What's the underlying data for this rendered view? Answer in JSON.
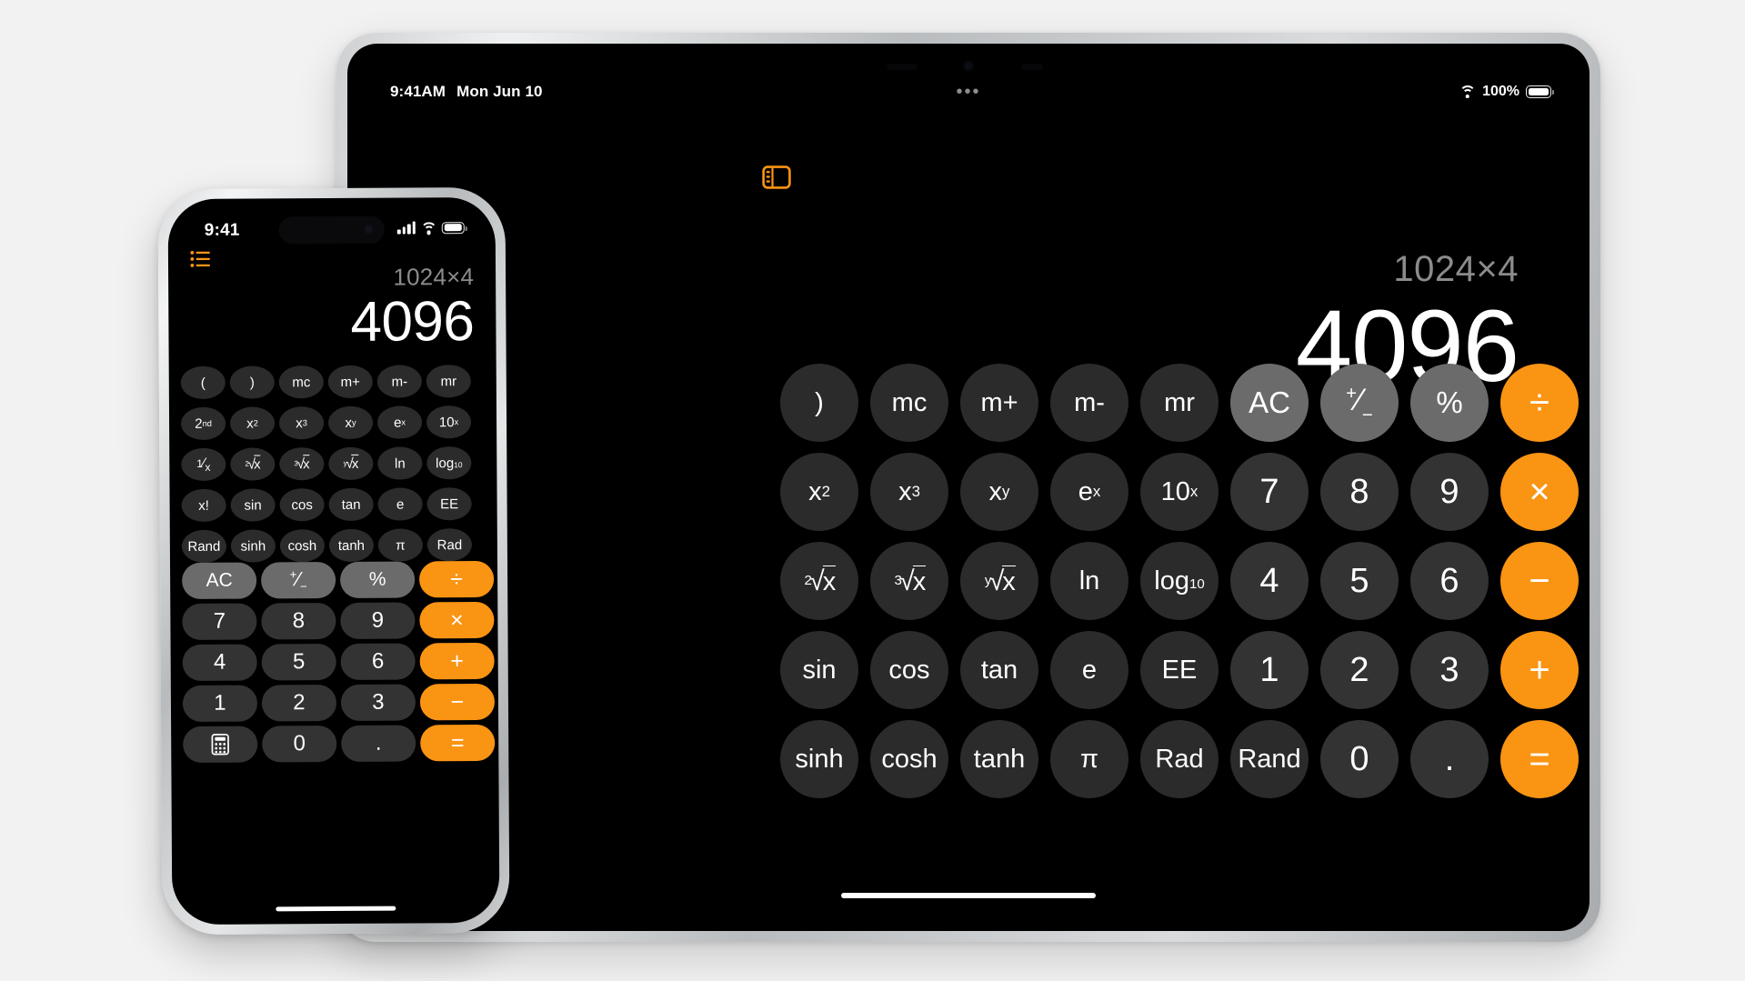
{
  "scene": {
    "background_color": "#f2f2f2"
  },
  "ipad": {
    "device_name": "iPad",
    "status_bar": {
      "time": "9:41AM",
      "date": "Mon Jun 10",
      "wifi_icon": "wifi-icon",
      "battery_percent": "100%",
      "battery_icon": "battery-full-icon"
    },
    "sidebar_icon": "sidebar-toggle-icon",
    "accent_color": "#fa9413",
    "display": {
      "expression": "1024×4",
      "result": "4096"
    },
    "keypad": [
      {
        "label": ")",
        "name": "paren-close",
        "kind": "fn"
      },
      {
        "label": "mc",
        "name": "memory-clear",
        "kind": "fn"
      },
      {
        "label": "m+",
        "name": "memory-add",
        "kind": "fn"
      },
      {
        "label": "m-",
        "name": "memory-subtract",
        "kind": "fn"
      },
      {
        "label": "mr",
        "name": "memory-recall",
        "kind": "fn"
      },
      {
        "label": "AC",
        "name": "all-clear",
        "kind": "util"
      },
      {
        "label": "+/-",
        "name": "plus-minus",
        "kind": "util",
        "glyph": "plusminus"
      },
      {
        "label": "%",
        "name": "percent",
        "kind": "util"
      },
      {
        "label": "÷",
        "name": "divide",
        "kind": "op"
      },
      {
        "label": "x2",
        "name": "x-squared",
        "kind": "fn",
        "glyph": "sup",
        "base": "x",
        "exp": "2"
      },
      {
        "label": "x3",
        "name": "x-cubed",
        "kind": "fn",
        "glyph": "sup",
        "base": "x",
        "exp": "3"
      },
      {
        "label": "xy",
        "name": "x-to-the-y",
        "kind": "fn",
        "glyph": "sup",
        "base": "x",
        "exp": "y"
      },
      {
        "label": "ex",
        "name": "e-to-the-x",
        "kind": "fn",
        "glyph": "sup",
        "base": "e",
        "exp": "x"
      },
      {
        "label": "10x",
        "name": "ten-to-the-x",
        "kind": "fn",
        "glyph": "sup",
        "base": "10",
        "exp": "x"
      },
      {
        "label": "7",
        "name": "digit-7",
        "kind": "num"
      },
      {
        "label": "8",
        "name": "digit-8",
        "kind": "num"
      },
      {
        "label": "9",
        "name": "digit-9",
        "kind": "num"
      },
      {
        "label": "×",
        "name": "multiply",
        "kind": "op"
      },
      {
        "label": "2√x",
        "name": "square-root",
        "kind": "fn",
        "glyph": "radical",
        "idx": "2"
      },
      {
        "label": "3√x",
        "name": "cube-root",
        "kind": "fn",
        "glyph": "radical",
        "idx": "3"
      },
      {
        "label": "y√x",
        "name": "y-root",
        "kind": "fn",
        "glyph": "radical",
        "idx": "y"
      },
      {
        "label": "ln",
        "name": "natural-log",
        "kind": "fn"
      },
      {
        "label": "log10",
        "name": "log-base-10",
        "kind": "fn",
        "glyph": "sub",
        "base": "log",
        "sub": "10"
      },
      {
        "label": "4",
        "name": "digit-4",
        "kind": "num"
      },
      {
        "label": "5",
        "name": "digit-5",
        "kind": "num"
      },
      {
        "label": "6",
        "name": "digit-6",
        "kind": "num"
      },
      {
        "label": "−",
        "name": "subtract",
        "kind": "op"
      },
      {
        "label": "sin",
        "name": "sine",
        "kind": "fn"
      },
      {
        "label": "cos",
        "name": "cosine",
        "kind": "fn"
      },
      {
        "label": "tan",
        "name": "tangent",
        "kind": "fn"
      },
      {
        "label": "e",
        "name": "euler-number",
        "kind": "fn"
      },
      {
        "label": "EE",
        "name": "exponent-entry",
        "kind": "fn"
      },
      {
        "label": "1",
        "name": "digit-1",
        "kind": "num"
      },
      {
        "label": "2",
        "name": "digit-2",
        "kind": "num"
      },
      {
        "label": "3",
        "name": "digit-3",
        "kind": "num"
      },
      {
        "label": "+",
        "name": "add",
        "kind": "op"
      },
      {
        "label": "sinh",
        "name": "hyperbolic-sine",
        "kind": "fn"
      },
      {
        "label": "cosh",
        "name": "hyperbolic-cosine",
        "kind": "fn"
      },
      {
        "label": "tanh",
        "name": "hyperbolic-tangent",
        "kind": "fn"
      },
      {
        "label": "π",
        "name": "pi",
        "kind": "fn"
      },
      {
        "label": "Rad",
        "name": "radians-toggle",
        "kind": "fn"
      },
      {
        "label": "Rand",
        "name": "random",
        "kind": "fn"
      },
      {
        "label": "0",
        "name": "digit-0",
        "kind": "num"
      },
      {
        "label": ".",
        "name": "decimal-point",
        "kind": "num"
      },
      {
        "label": "=",
        "name": "equals",
        "kind": "op"
      }
    ]
  },
  "iphone": {
    "device_name": "iPhone",
    "status_bar": {
      "time": "9:41",
      "cellular_icon": "cellular-signal-icon",
      "wifi_icon": "wifi-icon",
      "battery_icon": "battery-full-icon"
    },
    "sidebar_icon": "list-menu-icon",
    "display": {
      "expression": "1024×4",
      "result": "4096"
    },
    "scientific_keys": [
      {
        "label": "(",
        "name": "paren-open"
      },
      {
        "label": ")",
        "name": "paren-close"
      },
      {
        "label": "mc",
        "name": "memory-clear"
      },
      {
        "label": "m+",
        "name": "memory-add"
      },
      {
        "label": "m-",
        "name": "memory-subtract"
      },
      {
        "label": "mr",
        "name": "memory-recall"
      },
      {
        "label": "2nd",
        "name": "second-function",
        "glyph": "sup",
        "base": "2",
        "exp": "nd"
      },
      {
        "label": "x2",
        "name": "x-squared",
        "glyph": "sup",
        "base": "x",
        "exp": "2"
      },
      {
        "label": "x3",
        "name": "x-cubed",
        "glyph": "sup",
        "base": "x",
        "exp": "3"
      },
      {
        "label": "xy",
        "name": "x-to-the-y",
        "glyph": "sup",
        "base": "x",
        "exp": "y"
      },
      {
        "label": "ex",
        "name": "e-to-the-x",
        "glyph": "sup",
        "base": "e",
        "exp": "x"
      },
      {
        "label": "10x",
        "name": "ten-to-the-x",
        "glyph": "sup",
        "base": "10",
        "exp": "x"
      },
      {
        "label": "1/x",
        "name": "reciprocal",
        "glyph": "frac"
      },
      {
        "label": "2√x",
        "name": "square-root",
        "glyph": "radical",
        "idx": "2"
      },
      {
        "label": "3√x",
        "name": "cube-root",
        "glyph": "radical",
        "idx": "3"
      },
      {
        "label": "y√x",
        "name": "y-root",
        "glyph": "radical",
        "idx": "y"
      },
      {
        "label": "ln",
        "name": "natural-log"
      },
      {
        "label": "log10",
        "name": "log-base-10",
        "glyph": "sub",
        "base": "log",
        "sub": "10"
      },
      {
        "label": "x!",
        "name": "factorial"
      },
      {
        "label": "sin",
        "name": "sine"
      },
      {
        "label": "cos",
        "name": "cosine"
      },
      {
        "label": "tan",
        "name": "tangent"
      },
      {
        "label": "e",
        "name": "euler-number"
      },
      {
        "label": "EE",
        "name": "exponent-entry"
      },
      {
        "label": "Rand",
        "name": "random"
      },
      {
        "label": "sinh",
        "name": "hyperbolic-sine"
      },
      {
        "label": "cosh",
        "name": "hyperbolic-cosine"
      },
      {
        "label": "tanh",
        "name": "hyperbolic-tangent"
      },
      {
        "label": "π",
        "name": "pi"
      },
      {
        "label": "Rad",
        "name": "radians-toggle"
      }
    ],
    "basic_keys": [
      {
        "label": "AC",
        "name": "all-clear",
        "kind": "util"
      },
      {
        "label": "+/-",
        "name": "plus-minus",
        "kind": "util",
        "glyph": "plusminus"
      },
      {
        "label": "%",
        "name": "percent",
        "kind": "util"
      },
      {
        "label": "÷",
        "name": "divide",
        "kind": "op"
      },
      {
        "label": "7",
        "name": "digit-7",
        "kind": "num"
      },
      {
        "label": "8",
        "name": "digit-8",
        "kind": "num"
      },
      {
        "label": "9",
        "name": "digit-9",
        "kind": "num"
      },
      {
        "label": "×",
        "name": "multiply",
        "kind": "op"
      },
      {
        "label": "4",
        "name": "digit-4",
        "kind": "num"
      },
      {
        "label": "5",
        "name": "digit-5",
        "kind": "num"
      },
      {
        "label": "6",
        "name": "digit-6",
        "kind": "num"
      },
      {
        "label": "+",
        "name": "add",
        "kind": "op"
      },
      {
        "label": "1",
        "name": "digit-1",
        "kind": "num"
      },
      {
        "label": "2",
        "name": "digit-2",
        "kind": "num"
      },
      {
        "label": "3",
        "name": "digit-3",
        "kind": "num"
      },
      {
        "label": "−",
        "name": "subtract",
        "kind": "op"
      },
      {
        "label": "calculator-icon",
        "name": "calculator-mode",
        "kind": "num",
        "glyph": "calcicon"
      },
      {
        "label": "0",
        "name": "digit-0",
        "kind": "num"
      },
      {
        "label": ".",
        "name": "decimal-point",
        "kind": "num"
      },
      {
        "label": "=",
        "name": "equals",
        "kind": "op"
      }
    ]
  }
}
